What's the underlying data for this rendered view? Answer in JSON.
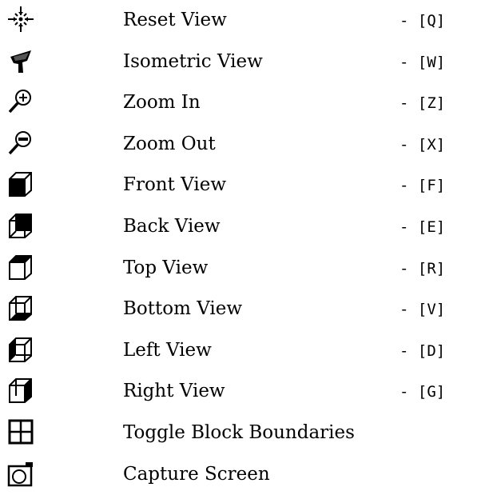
{
  "commands": [
    {
      "id": "reset-view",
      "icon": "reset-view-icon",
      "label": "Reset View",
      "shortcut": "- [Q]"
    },
    {
      "id": "isometric-view",
      "icon": "isometric-view-icon",
      "label": "Isometric View",
      "shortcut": "- [W]"
    },
    {
      "id": "zoom-in",
      "icon": "zoom-in-icon",
      "label": "Zoom In",
      "shortcut": "- [Z]"
    },
    {
      "id": "zoom-out",
      "icon": "zoom-out-icon",
      "label": "Zoom Out",
      "shortcut": "- [X]"
    },
    {
      "id": "front-view",
      "icon": "front-view-icon",
      "label": "Front View",
      "shortcut": "- [F]"
    },
    {
      "id": "back-view",
      "icon": "back-view-icon",
      "label": "Back View",
      "shortcut": "- [E]"
    },
    {
      "id": "top-view",
      "icon": "top-view-icon",
      "label": "Top View",
      "shortcut": "- [R]"
    },
    {
      "id": "bottom-view",
      "icon": "bottom-view-icon",
      "label": "Bottom View",
      "shortcut": "- [V]"
    },
    {
      "id": "left-view",
      "icon": "left-view-icon",
      "label": "Left View",
      "shortcut": "- [D]"
    },
    {
      "id": "right-view",
      "icon": "right-view-icon",
      "label": "Right View",
      "shortcut": "- [G]"
    },
    {
      "id": "toggle-block-boundaries",
      "icon": "block-boundaries-icon",
      "label": "Toggle Block Boundaries",
      "shortcut": ""
    },
    {
      "id": "capture-screen",
      "icon": "capture-screen-icon",
      "label": "Capture Screen",
      "shortcut": ""
    }
  ]
}
